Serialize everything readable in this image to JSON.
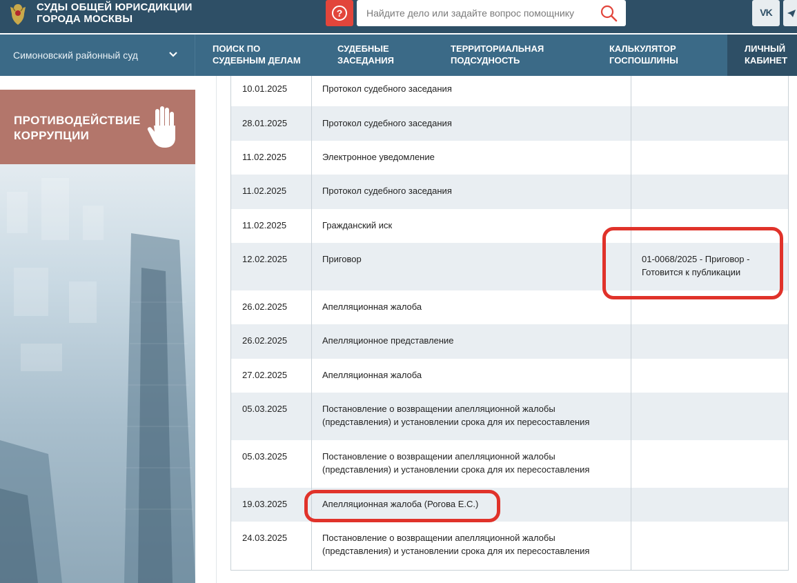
{
  "header": {
    "site_title_line1": "Суды общей юрисдикции",
    "site_title_line2": "города Москвы",
    "help_label": "?",
    "search_placeholder": "Найдите дело или задайте вопрос помощнику",
    "vk_label": "VK"
  },
  "nav": {
    "court_name": "Симоновский районный суд",
    "items": [
      {
        "line1": "Поиск по",
        "line2": "судебным делам"
      },
      {
        "line1": "Судебные",
        "line2": "заседания"
      },
      {
        "line1": "Территориальная",
        "line2": "подсудность"
      },
      {
        "line1": "Калькулятор",
        "line2": "госпошлины"
      },
      {
        "line1": "Личный",
        "line2": "кабинет"
      }
    ]
  },
  "sidebar": {
    "anticorruption_line1": "Противодействие",
    "anticorruption_line2": "коррупции"
  },
  "documents": {
    "rows": [
      {
        "date": "10.01.2025",
        "doc": "Протокол судебного заседания",
        "note": ""
      },
      {
        "date": "28.01.2025",
        "doc": "Протокол судебного заседания",
        "note": ""
      },
      {
        "date": "11.02.2025",
        "doc": "Электронное уведомление",
        "note": ""
      },
      {
        "date": "11.02.2025",
        "doc": "Протокол судебного заседания",
        "note": ""
      },
      {
        "date": "11.02.2025",
        "doc": "Гражданский иск",
        "note": ""
      },
      {
        "date": "12.02.2025",
        "doc": "Приговор",
        "note": "01-0068/2025 - Приговор - Готовится к публикации"
      },
      {
        "date": "26.02.2025",
        "doc": "Апелляционная жалоба",
        "note": ""
      },
      {
        "date": "26.02.2025",
        "doc": "Апелляционное представление",
        "note": ""
      },
      {
        "date": "27.02.2025",
        "doc": "Апелляционная жалоба",
        "note": ""
      },
      {
        "date": "05.03.2025",
        "doc": "Постановление о возвращении апелляционной жалобы (представления) и установлении срока для их пересоставления",
        "note": ""
      },
      {
        "date": "05.03.2025",
        "doc": "Постановление о возвращении апелляционной жалобы (представления) и установлении срока для их пересоставления",
        "note": ""
      },
      {
        "date": "19.03.2025",
        "doc": "Апелляционная жалоба (Рогова Е.С.)",
        "note": ""
      },
      {
        "date": "24.03.2025",
        "doc": "Постановление о возвращении апелляционной жалобы (представления) и установлении срока для их пересоставления",
        "note": ""
      }
    ]
  },
  "colors": {
    "header_bg": "#2e4f66",
    "nav_bg": "#3b6a87",
    "accent_red": "#e2453b",
    "anticorruption_bg": "#b3766b",
    "row_alt": "#e9eef2",
    "highlight": "#e0322a"
  }
}
